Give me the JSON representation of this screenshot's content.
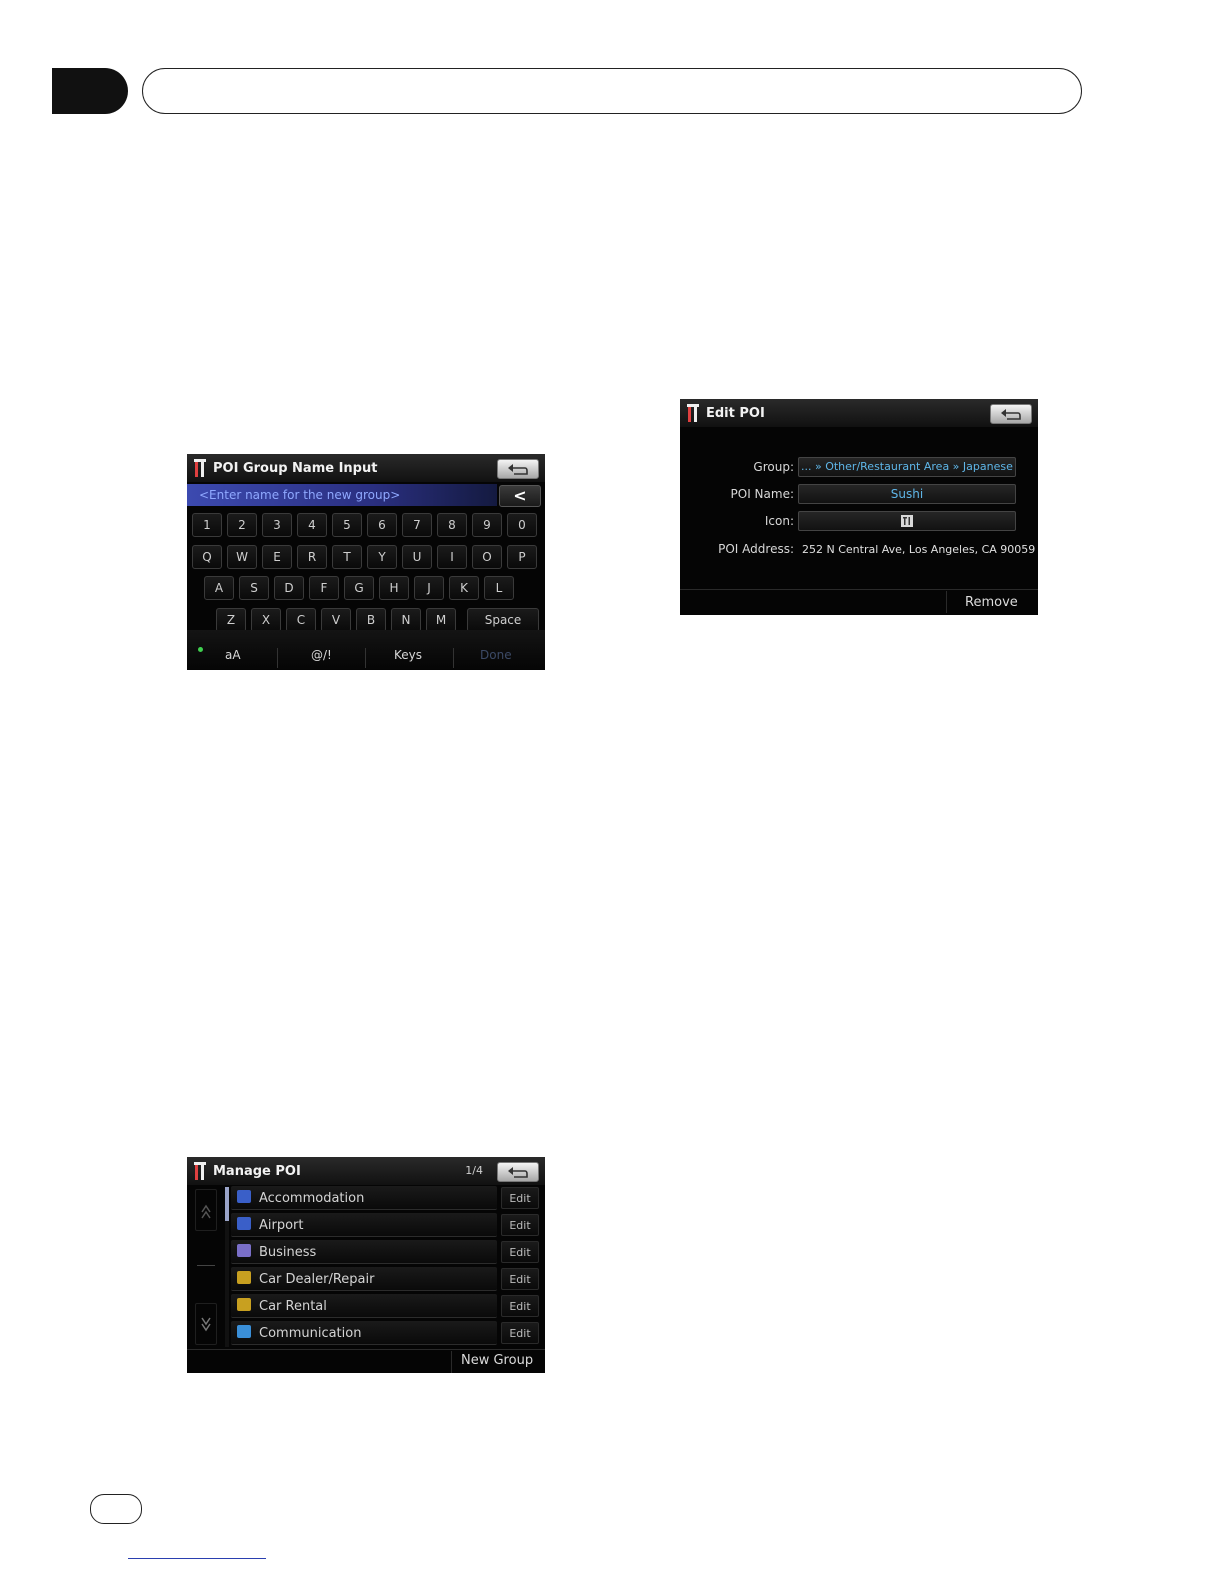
{
  "keyboard_screen": {
    "title": "POI Group Name Input",
    "input_placeholder": "<Enter name for the new group>",
    "backspace_label": "<",
    "rows": [
      [
        "1",
        "2",
        "3",
        "4",
        "5",
        "6",
        "7",
        "8",
        "9",
        "0"
      ],
      [
        "Q",
        "W",
        "E",
        "R",
        "T",
        "Y",
        "U",
        "I",
        "O",
        "P"
      ],
      [
        "A",
        "S",
        "D",
        "F",
        "G",
        "H",
        "J",
        "K",
        "L"
      ],
      [
        "Z",
        "X",
        "C",
        "V",
        "B",
        "N",
        "M"
      ]
    ],
    "space_label": "Space",
    "case_label": "aA",
    "symbols_label": "@/!",
    "keys_label": "Keys",
    "done_label": "Done"
  },
  "edit_poi_screen": {
    "title": "Edit POI",
    "group_label": "Group:",
    "group_value": "... » Other/Restaurant Area » Japanese",
    "name_label": "POI Name:",
    "name_value": "Sushi",
    "icon_label": "Icon:",
    "address_label": "POI Address:",
    "address_value": "252 N Central Ave, Los Angeles, CA 90059",
    "remove_label": "Remove"
  },
  "manage_poi_screen": {
    "title": "Manage POI",
    "page": "1/4",
    "items": [
      {
        "label": "Accommodation",
        "edit": "Edit",
        "icon": "bed-icon",
        "color": "#3a5fc8"
      },
      {
        "label": "Airport",
        "edit": "Edit",
        "icon": "airplane-icon",
        "color": "#3a5fc8"
      },
      {
        "label": "Business",
        "edit": "Edit",
        "icon": "building-icon",
        "color": "#7a6fc8"
      },
      {
        "label": "Car Dealer/Repair",
        "edit": "Edit",
        "icon": "car-repair-icon",
        "color": "#c8a020"
      },
      {
        "label": "Car Rental",
        "edit": "Edit",
        "icon": "car-rental-icon",
        "color": "#c8a020"
      },
      {
        "label": "Communication",
        "edit": "Edit",
        "icon": "communication-icon",
        "color": "#3a8fd8"
      }
    ],
    "new_group_label": "New Group"
  }
}
